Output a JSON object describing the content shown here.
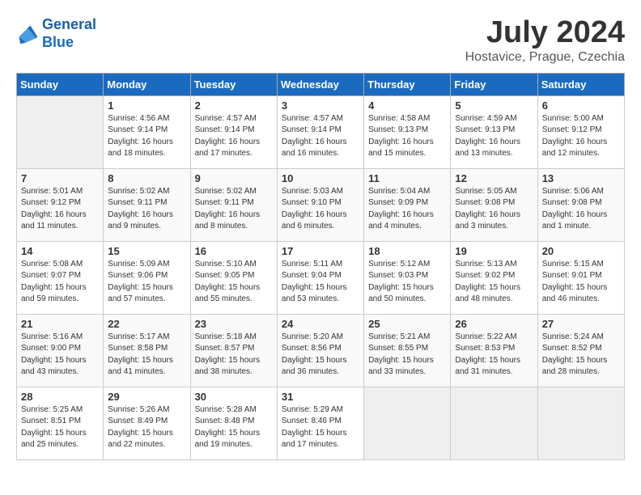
{
  "header": {
    "logo_line1": "General",
    "logo_line2": "Blue",
    "month": "July 2024",
    "location": "Hostavice, Prague, Czechia"
  },
  "weekdays": [
    "Sunday",
    "Monday",
    "Tuesday",
    "Wednesday",
    "Thursday",
    "Friday",
    "Saturday"
  ],
  "weeks": [
    [
      {
        "day": "",
        "empty": true
      },
      {
        "day": "1",
        "sunrise": "4:56 AM",
        "sunset": "9:14 PM",
        "daylight": "16 hours and 18 minutes."
      },
      {
        "day": "2",
        "sunrise": "4:57 AM",
        "sunset": "9:14 PM",
        "daylight": "16 hours and 17 minutes."
      },
      {
        "day": "3",
        "sunrise": "4:57 AM",
        "sunset": "9:14 PM",
        "daylight": "16 hours and 16 minutes."
      },
      {
        "day": "4",
        "sunrise": "4:58 AM",
        "sunset": "9:13 PM",
        "daylight": "16 hours and 15 minutes."
      },
      {
        "day": "5",
        "sunrise": "4:59 AM",
        "sunset": "9:13 PM",
        "daylight": "16 hours and 13 minutes."
      },
      {
        "day": "6",
        "sunrise": "5:00 AM",
        "sunset": "9:12 PM",
        "daylight": "16 hours and 12 minutes."
      }
    ],
    [
      {
        "day": "7",
        "sunrise": "5:01 AM",
        "sunset": "9:12 PM",
        "daylight": "16 hours and 11 minutes."
      },
      {
        "day": "8",
        "sunrise": "5:02 AM",
        "sunset": "9:11 PM",
        "daylight": "16 hours and 9 minutes."
      },
      {
        "day": "9",
        "sunrise": "5:02 AM",
        "sunset": "9:11 PM",
        "daylight": "16 hours and 8 minutes."
      },
      {
        "day": "10",
        "sunrise": "5:03 AM",
        "sunset": "9:10 PM",
        "daylight": "16 hours and 6 minutes."
      },
      {
        "day": "11",
        "sunrise": "5:04 AM",
        "sunset": "9:09 PM",
        "daylight": "16 hours and 4 minutes."
      },
      {
        "day": "12",
        "sunrise": "5:05 AM",
        "sunset": "9:08 PM",
        "daylight": "16 hours and 3 minutes."
      },
      {
        "day": "13",
        "sunrise": "5:06 AM",
        "sunset": "9:08 PM",
        "daylight": "16 hours and 1 minute."
      }
    ],
    [
      {
        "day": "14",
        "sunrise": "5:08 AM",
        "sunset": "9:07 PM",
        "daylight": "15 hours and 59 minutes."
      },
      {
        "day": "15",
        "sunrise": "5:09 AM",
        "sunset": "9:06 PM",
        "daylight": "15 hours and 57 minutes."
      },
      {
        "day": "16",
        "sunrise": "5:10 AM",
        "sunset": "9:05 PM",
        "daylight": "15 hours and 55 minutes."
      },
      {
        "day": "17",
        "sunrise": "5:11 AM",
        "sunset": "9:04 PM",
        "daylight": "15 hours and 53 minutes."
      },
      {
        "day": "18",
        "sunrise": "5:12 AM",
        "sunset": "9:03 PM",
        "daylight": "15 hours and 50 minutes."
      },
      {
        "day": "19",
        "sunrise": "5:13 AM",
        "sunset": "9:02 PM",
        "daylight": "15 hours and 48 minutes."
      },
      {
        "day": "20",
        "sunrise": "5:15 AM",
        "sunset": "9:01 PM",
        "daylight": "15 hours and 46 minutes."
      }
    ],
    [
      {
        "day": "21",
        "sunrise": "5:16 AM",
        "sunset": "9:00 PM",
        "daylight": "15 hours and 43 minutes."
      },
      {
        "day": "22",
        "sunrise": "5:17 AM",
        "sunset": "8:58 PM",
        "daylight": "15 hours and 41 minutes."
      },
      {
        "day": "23",
        "sunrise": "5:18 AM",
        "sunset": "8:57 PM",
        "daylight": "15 hours and 38 minutes."
      },
      {
        "day": "24",
        "sunrise": "5:20 AM",
        "sunset": "8:56 PM",
        "daylight": "15 hours and 36 minutes."
      },
      {
        "day": "25",
        "sunrise": "5:21 AM",
        "sunset": "8:55 PM",
        "daylight": "15 hours and 33 minutes."
      },
      {
        "day": "26",
        "sunrise": "5:22 AM",
        "sunset": "8:53 PM",
        "daylight": "15 hours and 31 minutes."
      },
      {
        "day": "27",
        "sunrise": "5:24 AM",
        "sunset": "8:52 PM",
        "daylight": "15 hours and 28 minutes."
      }
    ],
    [
      {
        "day": "28",
        "sunrise": "5:25 AM",
        "sunset": "8:51 PM",
        "daylight": "15 hours and 25 minutes."
      },
      {
        "day": "29",
        "sunrise": "5:26 AM",
        "sunset": "8:49 PM",
        "daylight": "15 hours and 22 minutes."
      },
      {
        "day": "30",
        "sunrise": "5:28 AM",
        "sunset": "8:48 PM",
        "daylight": "15 hours and 19 minutes."
      },
      {
        "day": "31",
        "sunrise": "5:29 AM",
        "sunset": "8:46 PM",
        "daylight": "15 hours and 17 minutes."
      },
      {
        "day": "",
        "empty": true
      },
      {
        "day": "",
        "empty": true
      },
      {
        "day": "",
        "empty": true
      }
    ]
  ]
}
